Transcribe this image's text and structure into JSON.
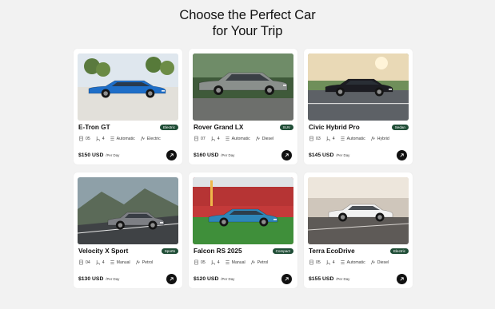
{
  "heading": {
    "line1": "Choose the Perfect Car",
    "line2": "for Your Trip"
  },
  "cars": [
    {
      "name": "E-Tron GT",
      "badge": "Electric",
      "doors": "05",
      "seats": "4",
      "transmission": "Automatic",
      "fuel": "Electric",
      "price": "$150 USD",
      "per": "/Per Day",
      "car_color": "#1e6ec8",
      "scene": "park"
    },
    {
      "name": "Rover Grand LX",
      "badge": "SUV",
      "doors": "07",
      "seats": "4",
      "transmission": "Automatic",
      "fuel": "Diesel",
      "price": "$160 USD",
      "per": "/Per Day",
      "car_color": "#8a8f8c",
      "scene": "forest"
    },
    {
      "name": "Civic Hybrid Pro",
      "badge": "Sedan",
      "doors": "03",
      "seats": "4",
      "transmission": "Automatic",
      "fuel": "Hybrid",
      "price": "$145 USD",
      "per": "/Per Day",
      "car_color": "#1c1c22",
      "scene": "sunset"
    },
    {
      "name": "Velocity X Sport",
      "badge": "Sports",
      "doors": "04",
      "seats": "4",
      "transmission": "Manual",
      "fuel": "Petrol",
      "price": "$130 USD",
      "per": "/Per Day",
      "car_color": "#7d7f84",
      "scene": "mountain"
    },
    {
      "name": "Falcon RS 2025",
      "badge": "Compact",
      "doors": "05",
      "seats": "4",
      "transmission": "Manual",
      "fuel": "Petrol",
      "price": "$120 USD",
      "per": "/Per Day",
      "car_color": "#2e86b8",
      "scene": "stadium"
    },
    {
      "name": "Terra EcoDrive",
      "badge": "Electric",
      "doors": "05",
      "seats": "4",
      "transmission": "Automatic",
      "fuel": "Diesel",
      "price": "$155 USD",
      "per": "/Per Day",
      "car_color": "#f2f2f2",
      "scene": "highway"
    }
  ],
  "icons": {
    "doors": "door-icon",
    "seats": "seat-icon",
    "transmission": "gearbox-icon",
    "fuel": "fuel-icon",
    "cta": "arrow-up-right-icon"
  },
  "colors": {
    "badge_bg": "#1f4d36",
    "card_bg": "#ffffff",
    "page_bg": "#f2f2f2",
    "cta_bg": "#111111"
  }
}
